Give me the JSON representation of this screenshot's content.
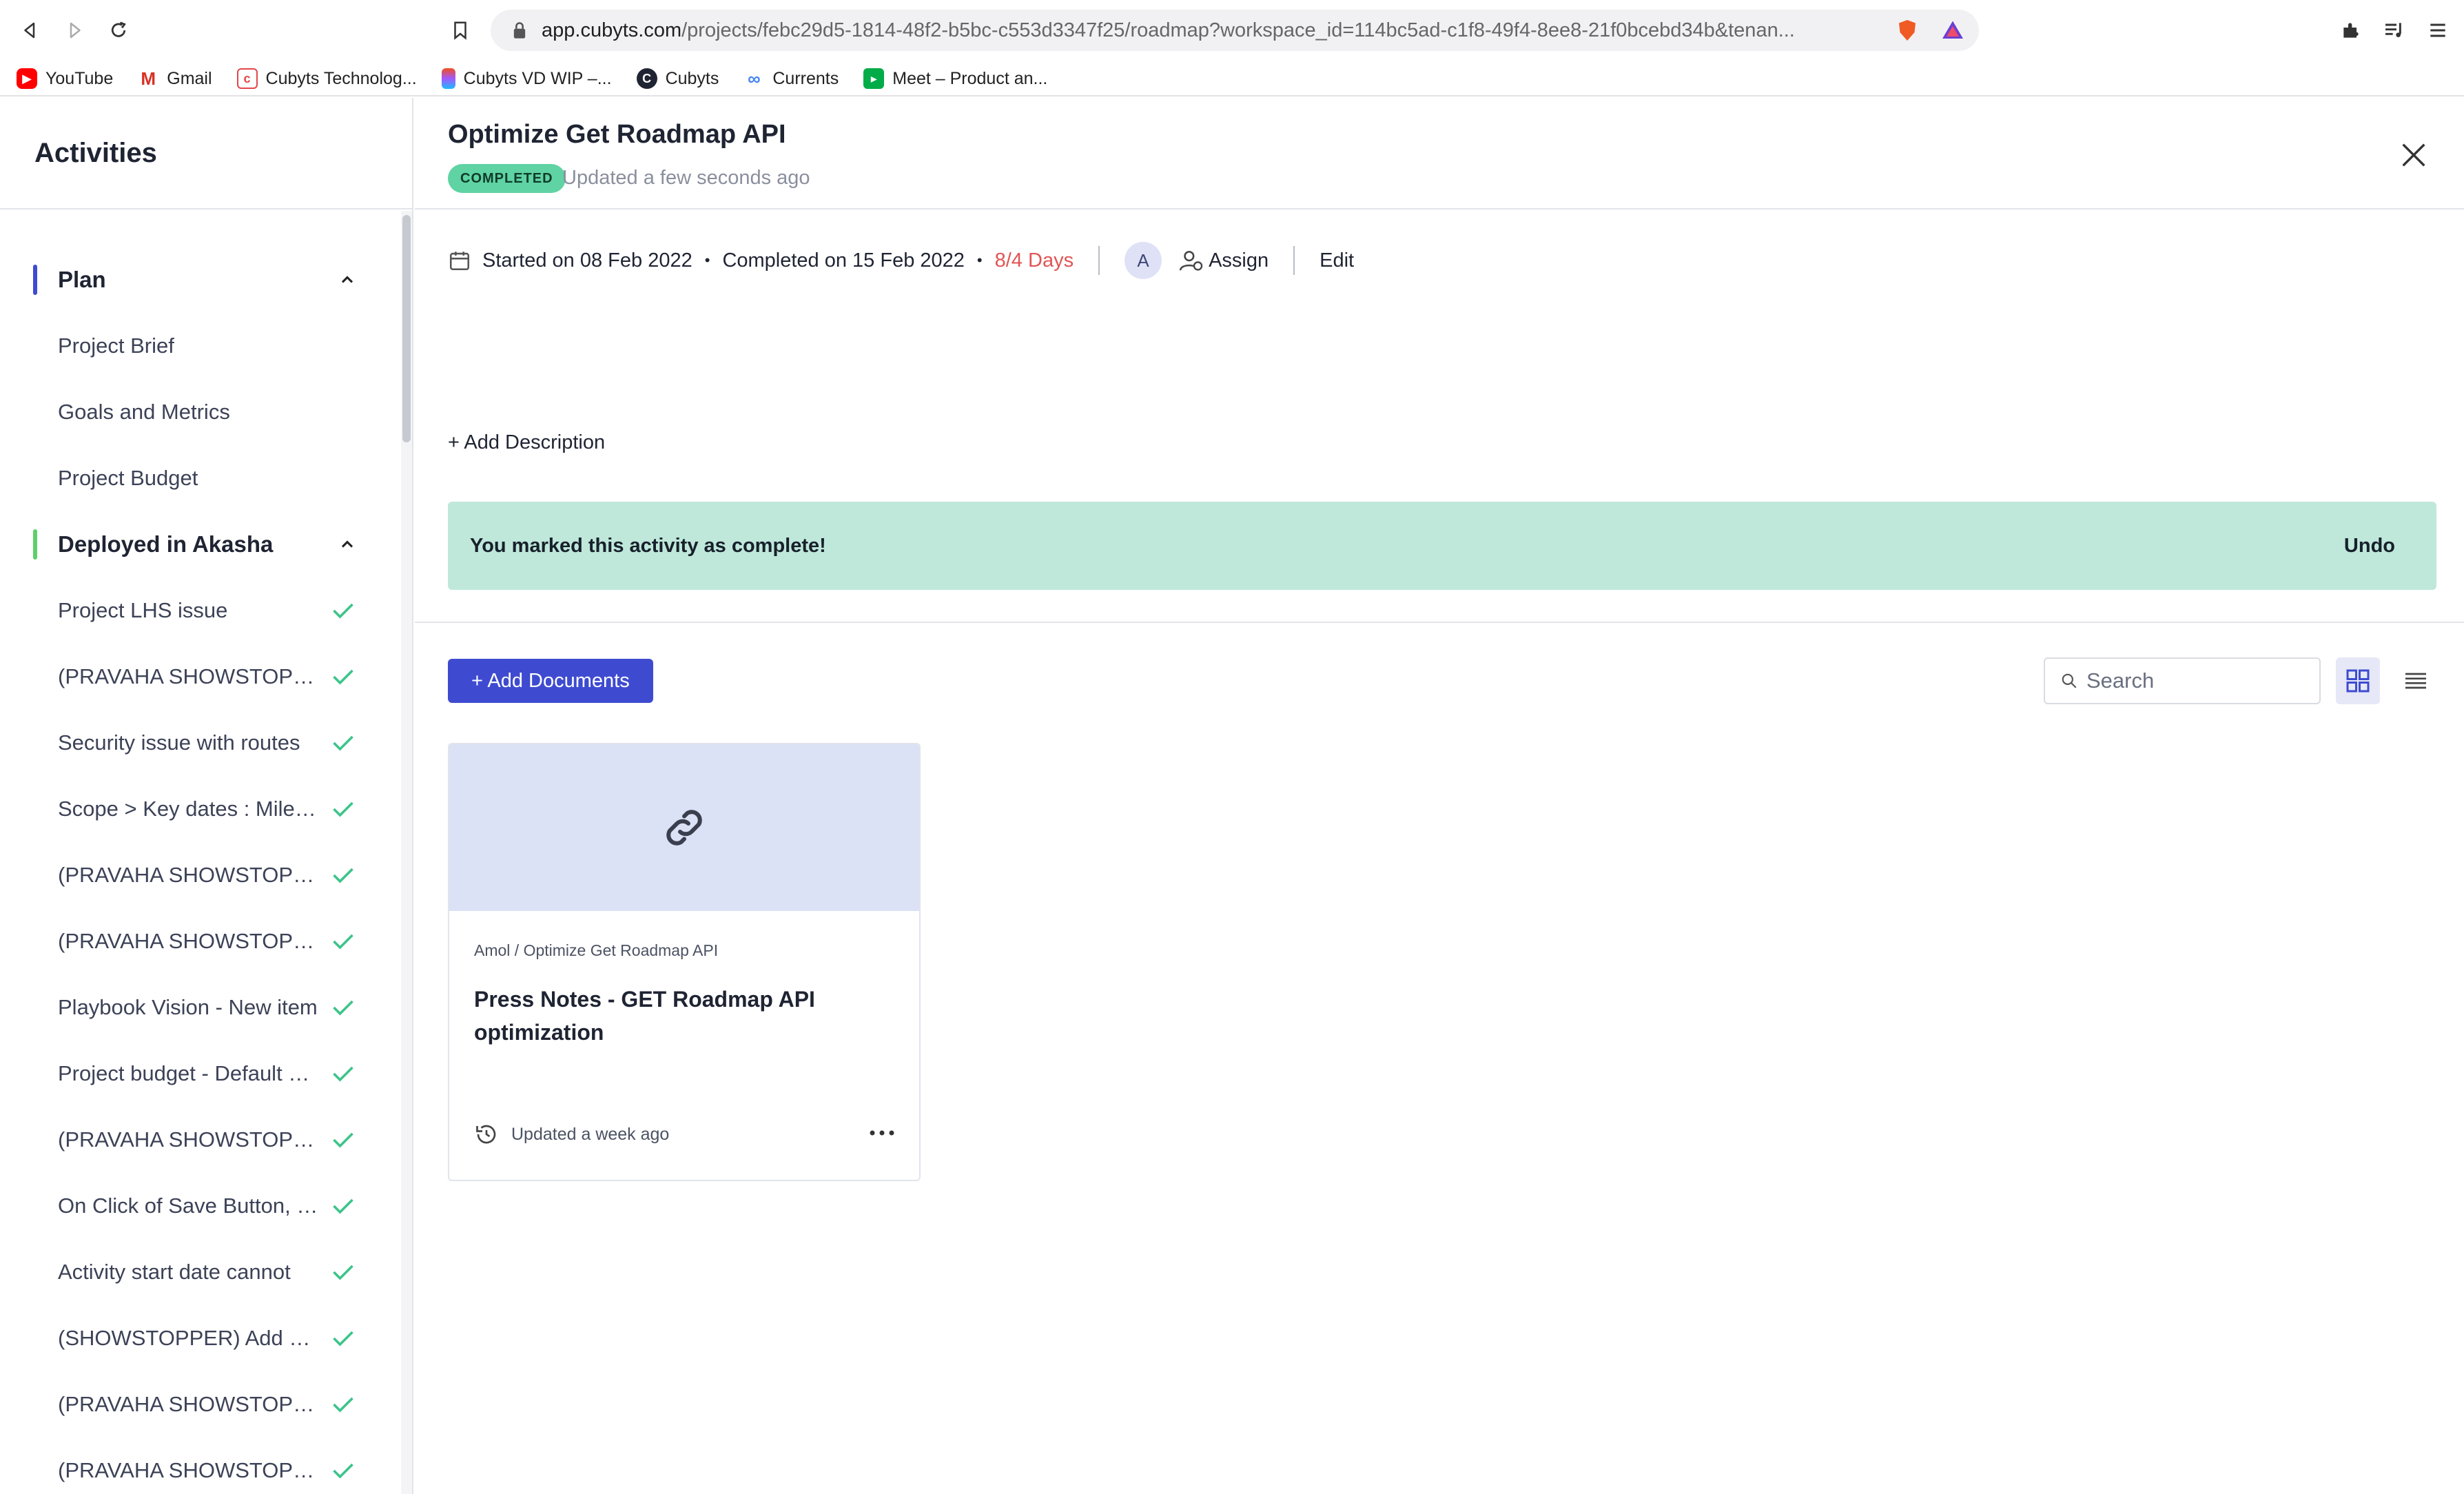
{
  "browser": {
    "url_host": "app.cubyts.com",
    "url_rest": "/projects/febc29d5-1814-48f2-b5bc-c553d3347f25/roadmap?workspace_id=114bc5ad-c1f8-49f4-8ee8-21f0bcebd34b&tenan...",
    "bookmarks": [
      {
        "label": "YouTube"
      },
      {
        "label": "Gmail"
      },
      {
        "label": "Cubyts Technolog..."
      },
      {
        "label": "Cubyts VD WIP –..."
      },
      {
        "label": "Cubyts"
      },
      {
        "label": "Currents"
      },
      {
        "label": "Meet – Product an..."
      }
    ]
  },
  "sidebar": {
    "title": "Activities",
    "groups": [
      {
        "label": "Plan",
        "color": "#3e4bd1",
        "items": [
          {
            "label": "Project Brief"
          },
          {
            "label": "Goals and Metrics"
          },
          {
            "label": "Project Budget"
          }
        ]
      },
      {
        "label": "Deployed in Akasha",
        "color": "#5fcf6a",
        "items": [
          {
            "label": "Project LHS issue"
          },
          {
            "label": "(PRAVAHA SHOWSTOPPER) Project"
          },
          {
            "label": "Security issue with routes"
          },
          {
            "label": "Scope > Key dates : Milestones"
          },
          {
            "label": "(PRAVAHA SHOWSTOPPER) Activity"
          },
          {
            "label": "(PRAVAHA SHOWSTOPPER) Roadmap"
          },
          {
            "label": "Playbook Vision - New item"
          },
          {
            "label": "Project budget - Default currency"
          },
          {
            "label": "(PRAVAHA SHOWSTOPPER) Budget"
          },
          {
            "label": "On Click of Save Button, the"
          },
          {
            "label": "Activity start date cannot"
          },
          {
            "label": "(SHOWSTOPPER) Add Project"
          },
          {
            "label": "(PRAVAHA SHOWSTOPPER) Docs"
          },
          {
            "label": "(PRAVAHA SHOWSTOPPER) Users"
          }
        ]
      }
    ]
  },
  "activity": {
    "title": "Optimize Get Roadmap API",
    "status": "COMPLETED",
    "updated": "Updated a few seconds ago",
    "started": "Started on 08 Feb 2022",
    "completed": "Completed on 15 Feb 2022",
    "days": "8/4 Days",
    "avatar_initial": "A",
    "assign_label": "Assign",
    "edit_label": "Edit",
    "add_description": "+ Add Description",
    "banner_text": "You marked this activity as complete!",
    "undo_label": "Undo",
    "status_color": "#5fd3a3"
  },
  "documents": {
    "add_label": "+ Add Documents",
    "search_placeholder": "Search",
    "cards": [
      {
        "path": "Amol / Optimize Get Roadmap API",
        "title": "Press Notes - GET Roadmap API optimization",
        "updated": "Updated a week ago"
      }
    ]
  }
}
